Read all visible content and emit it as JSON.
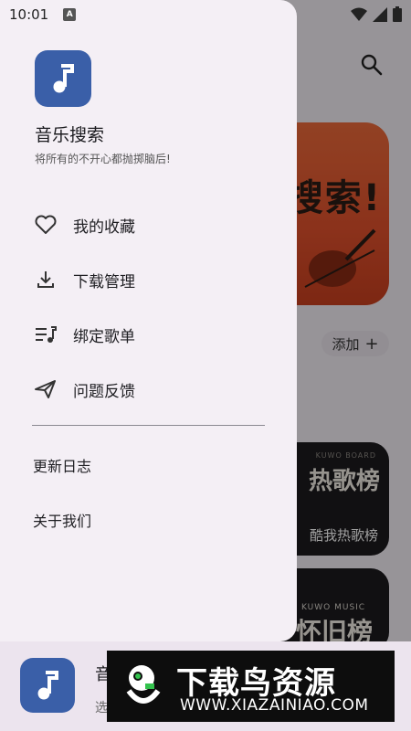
{
  "status_bar": {
    "time": "10:01",
    "notification_badge": "A"
  },
  "drawer": {
    "app_title": "音乐搜索",
    "app_subtitle": "将所有的不开心都抛掷脑后!",
    "menu": [
      {
        "icon": "heart-icon",
        "label": "我的收藏"
      },
      {
        "icon": "download-icon",
        "label": "下载管理"
      },
      {
        "icon": "playlist-icon",
        "label": "绑定歌单"
      },
      {
        "icon": "send-icon",
        "label": "问题反馈"
      }
    ],
    "links": [
      "更新日志",
      "关于我们"
    ]
  },
  "background": {
    "banner_text": "搜索!",
    "add_button": "添加",
    "hot_card": {
      "tag": "KUWO BOARD",
      "title": "热歌榜",
      "subtitle": "酷我热歌榜"
    },
    "old_card": {
      "tag": "KUWO MUSIC",
      "title": "怀旧榜"
    }
  },
  "player": {
    "title": "音",
    "subtitle": "选"
  },
  "watermark": {
    "title": "下载鸟资源",
    "url": "WWW.XIAZAINIAO.COM"
  },
  "colors": {
    "accent": "#3a5fa8",
    "drawer_bg": "#f4eff5",
    "banner": "#e0502c"
  }
}
